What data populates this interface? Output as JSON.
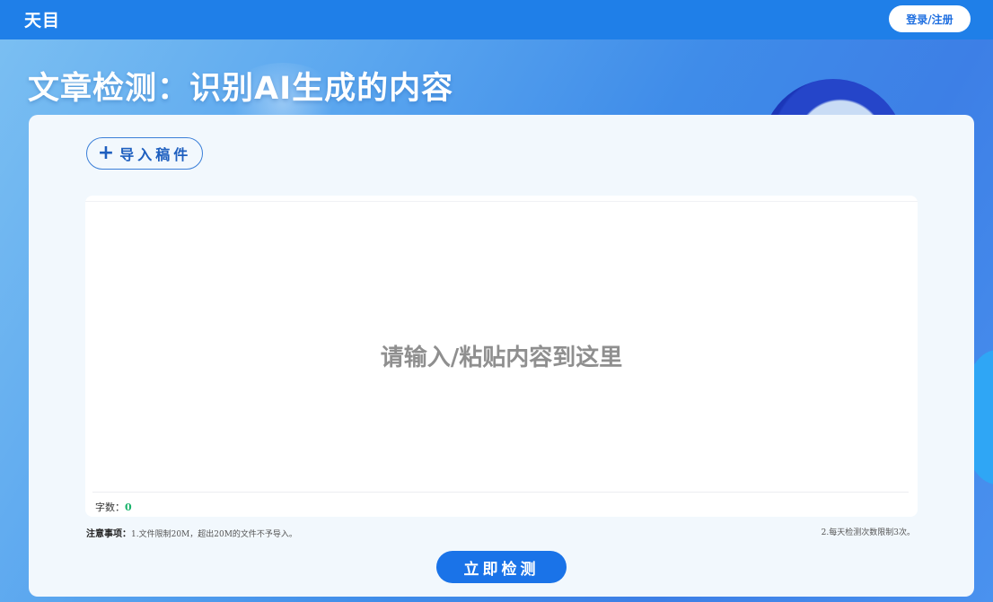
{
  "header": {
    "logo": "天目",
    "login_label": "登录/注册"
  },
  "page": {
    "title": "文章检测：识别AI生成的内容"
  },
  "card": {
    "import_label": "导入稿件",
    "import_icon": "plus-icon",
    "editor_placeholder": "请输入/粘贴内容到这里",
    "editor_value": "",
    "word_count_label": "字数：",
    "word_count_value": "0",
    "notes_label": "注意事项：",
    "note_1": "1.文件限制20M，超出20M的文件不予导入。",
    "note_2": "2.每天检测次数限制3次。",
    "detect_label": "立即检测"
  },
  "colors": {
    "topbar": "#1f7fe8",
    "primary_button": "#1a73e8",
    "word_count_value": "#19b36b"
  }
}
